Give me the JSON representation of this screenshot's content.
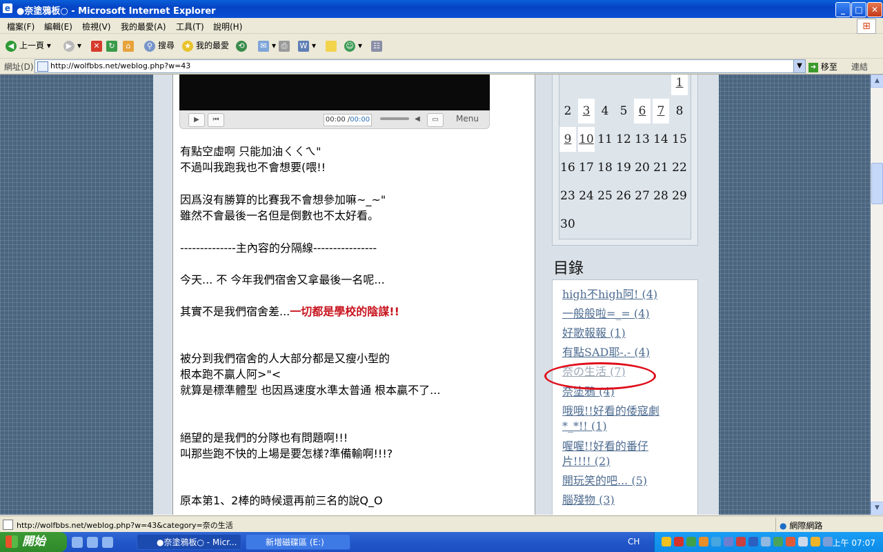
{
  "window": {
    "title": "●奈塗鴉板○ - Microsoft Internet Explorer",
    "minimize": "_",
    "maximize": "□",
    "close": "✕"
  },
  "menu": [
    "檔案(F)",
    "編輯(E)",
    "檢視(V)",
    "我的最愛(A)",
    "工具(T)",
    "說明(H)"
  ],
  "toolbar": {
    "back_label": "上一頁",
    "search_label": "搜尋",
    "favorites_label": "我的最愛"
  },
  "address": {
    "label": "網址(D)",
    "url": "http://wolfbbs.net/weblog.php?w=43",
    "go_label": "移至",
    "links_label": "連結"
  },
  "player": {
    "time_current": "00:00",
    "time_sep": " /",
    "time_total": "00:00",
    "menu_label": "Menu"
  },
  "post": {
    "lines": [
      "有點空虛啊 只能加油ㄑㄑㄟ\"",
      "不過叫我跑我也不會想要(喂!!",
      "因爲沒有勝算的比賽我不會想參加嘛~_~\"",
      "雖然不會最後一名但是倒數也不太好看。",
      "--------------主內容的分隔線----------------",
      "今天... 不 今年我們宿舍又拿最後一名呢...",
      "其實不是我們宿舍差...",
      "被分到我們宿舍的人大部分都是又瘦小型的",
      "根本跑不贏人阿>\"<",
      "就算是標準體型 也因爲速度水準太普通 根本贏不了...",
      "絕望的是我們的分隊也有問題啊!!!",
      "叫那些跑不快的上場是要怎樣?準備輸啊!!!?",
      "原本第1、2棒的時候還再前三名的說Q_O"
    ],
    "highlight": "一切都是學校的陰謀!!"
  },
  "calendar": {
    "days": [
      "1",
      "2",
      "3",
      "4",
      "5",
      "6",
      "7",
      "8",
      "9",
      "10",
      "11",
      "12",
      "13",
      "14",
      "15",
      "16",
      "17",
      "18",
      "19",
      "20",
      "21",
      "22",
      "23",
      "24",
      "25",
      "26",
      "27",
      "28",
      "29",
      "30"
    ],
    "linked": [
      "1",
      "3",
      "6",
      "7",
      "9",
      "10"
    ]
  },
  "toc": {
    "title": "目錄",
    "items": [
      "high不high阿! (4)",
      "一般般啦=_= (4)",
      "好歌報報 (1)",
      "有點SAD耶-.- (4)",
      "奈の生活 (7)",
      "奈塗鴉 (4)",
      "哦哦!!好看的倭寇劇",
      "*_*!! (1)",
      "喔喔!!好看的番仔",
      "片!!!! (2)",
      "開玩笑的吧... (5)",
      "腦殘物 (3)"
    ]
  },
  "status": {
    "url": "http://wolfbbs.net/weblog.php?w=43&category=奈の生活",
    "zone": "網際網路"
  },
  "taskbar": {
    "start_label": "開始",
    "tasks": [
      "●奈塗鴉板○ - Micr...",
      "新增磁碟區 (E:)"
    ],
    "lang": "CH",
    "clock": "上午 07:07"
  },
  "colors": {
    "accent_red": "#c8141e",
    "link": "#4d6b90",
    "circle": "#e00d1a"
  }
}
